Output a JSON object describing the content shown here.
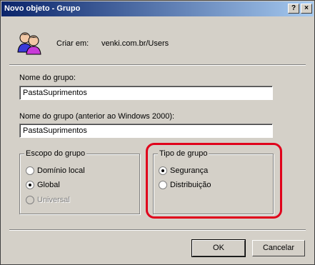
{
  "window": {
    "title": "Novo objeto - Grupo",
    "help_button": "?",
    "close_button": "×"
  },
  "header": {
    "create_in_label": "Criar em:",
    "create_in_value": "venki.com.br/Users",
    "icon": "users-group-icon"
  },
  "fields": {
    "group_name_label": "Nome do grupo:",
    "group_name_value": "PastaSuprimentos",
    "pre2000_label": "Nome do grupo (anterior ao Windows 2000):",
    "pre2000_value": "PastaSuprimentos"
  },
  "scope": {
    "legend": "Escopo do grupo",
    "options": [
      {
        "label": "Domínio local",
        "checked": false,
        "enabled": true
      },
      {
        "label": "Global",
        "checked": true,
        "enabled": true
      },
      {
        "label": "Universal",
        "checked": false,
        "enabled": false
      }
    ]
  },
  "type": {
    "legend": "Tipo de grupo",
    "options": [
      {
        "label": "Segurança",
        "checked": true,
        "enabled": true
      },
      {
        "label": "Distribuição",
        "checked": false,
        "enabled": true
      }
    ]
  },
  "buttons": {
    "ok": "OK",
    "cancel": "Cancelar"
  },
  "colors": {
    "highlight": "#e0001b",
    "titlebar_start": "#0a246a",
    "titlebar_end": "#a6caf0"
  }
}
